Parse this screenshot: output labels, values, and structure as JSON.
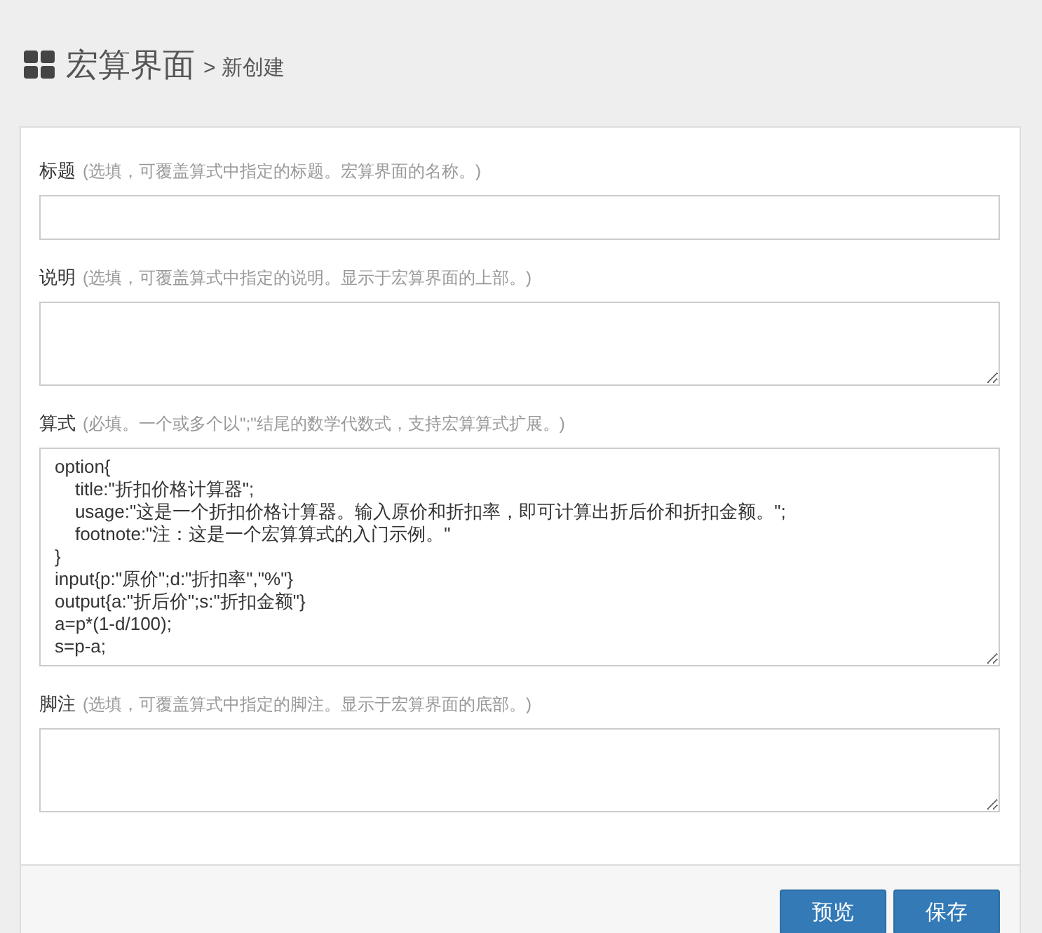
{
  "header": {
    "title": "宏算界面",
    "breadcrumb": "> 新创建"
  },
  "fields": [
    {
      "kind": "input",
      "label": "标题",
      "hint": "(选填，可覆盖算式中指定的标题。宏算界面的名称。)"
    },
    {
      "kind": "textarea",
      "label": "说明",
      "hint": "(选填，可覆盖算式中指定的说明。显示于宏算界面的上部。)"
    },
    {
      "kind": "textarea",
      "label": "算式",
      "hint": "(必填。一个或多个以\";\"结尾的数学代数式，支持宏算算式扩展。)",
      "value": "option{\n    title:\"折扣价格计算器\";\n    usage:\"这是一个折扣价格计算器。输入原价和折扣率，即可计算出折后价和折扣金额。\";\n    footnote:\"注：这是一个宏算算式的入门示例。\"\n}\ninput{p:\"原价\";d:\"折扣率\",\"%\"}\noutput{a:\"折后价\";s:\"折扣金额\"}\na=p*(1-d/100);\ns=p-a;"
    },
    {
      "kind": "textarea",
      "label": "脚注",
      "hint": "(选填，可覆盖算式中指定的脚注。显示于宏算界面的底部。)"
    }
  ],
  "buttons": [
    "预览",
    "保存"
  ]
}
